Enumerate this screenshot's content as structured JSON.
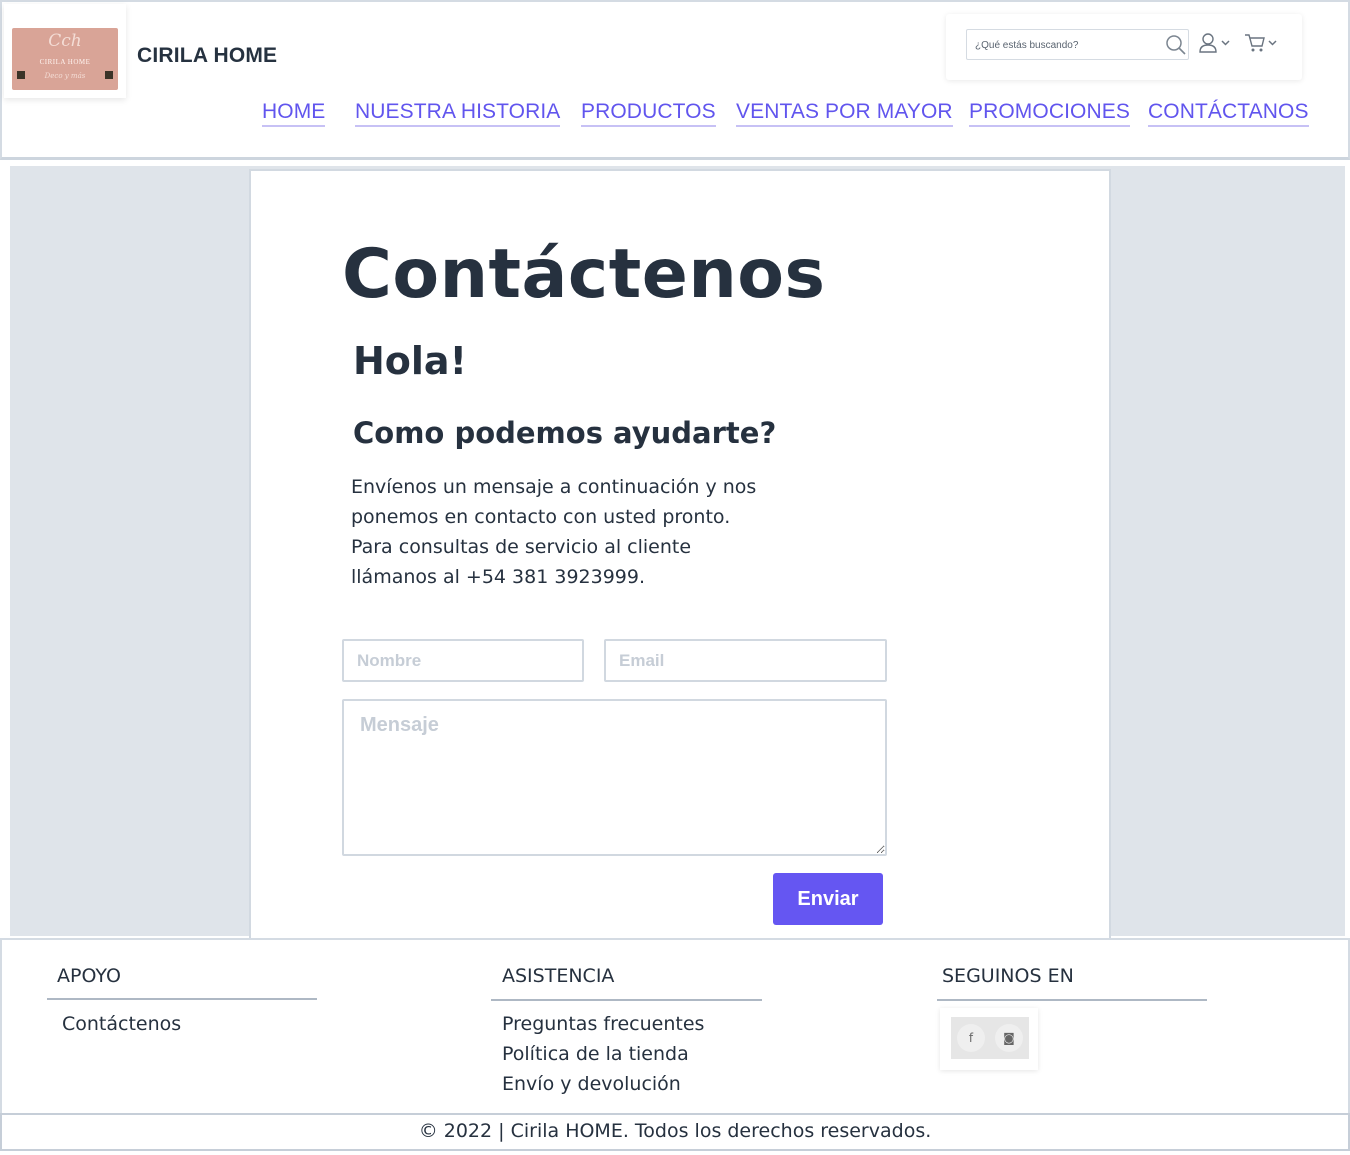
{
  "header": {
    "logo": {
      "monogram": "Cch",
      "name": "CIRILA HOME",
      "tagline": "Deco y más"
    },
    "brand": "CIRILA HOME",
    "search": {
      "placeholder": "¿Qué estás buscando?",
      "icon": "search-icon"
    },
    "account_icon": "user-icon",
    "cart_icon": "cart-icon",
    "nav": [
      {
        "label": "HOME"
      },
      {
        "label": "NUESTRA HISTORIA"
      },
      {
        "label": "PRODUCTOS"
      },
      {
        "label": "VENTAS POR MAYOR"
      },
      {
        "label": "PROMOCIONES"
      },
      {
        "label": "CONTÁCTANOS"
      }
    ]
  },
  "main": {
    "title": "Contáctenos",
    "greeting": "Hola!",
    "subtitle": "Como podemos ayudarte?",
    "intro_lines": [
      "Envíenos un mensaje a continuación y nos",
      "ponemos en contacto con usted pronto.",
      "Para consultas de servicio al cliente",
      "llámanos al +54 381 3923999."
    ],
    "form": {
      "name_placeholder": "Nombre",
      "email_placeholder": "Email",
      "message_placeholder": "Mensaje",
      "submit_label": "Enviar"
    }
  },
  "footer": {
    "columns": [
      {
        "title": "APOYO",
        "links": [
          "Contáctenos"
        ]
      },
      {
        "title": "ASISTENCIA",
        "links": [
          "Preguntas frecuentes",
          "Política de la tienda",
          "Envío y devolución"
        ]
      },
      {
        "title": "SEGUINOS EN",
        "links": []
      }
    ],
    "social": [
      {
        "icon": "facebook-icon",
        "glyph": "f"
      },
      {
        "icon": "instagram-icon",
        "glyph": "◙"
      }
    ],
    "copyright": "© 2022 | Cirila HOME. Todos los derechos reservados."
  },
  "colors": {
    "accent": "#6556f2",
    "nav_link": "#6155ee",
    "text": "#26313f",
    "page_bg": "#dfe4ea",
    "logo_bg": "#d9a497"
  }
}
